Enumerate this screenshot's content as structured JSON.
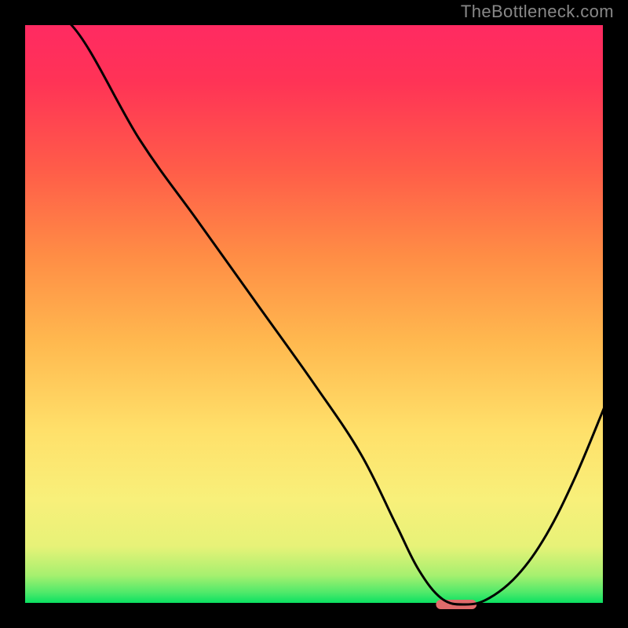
{
  "watermark": "TheBottleneck.com",
  "chart_data": {
    "type": "line",
    "title": "",
    "xlabel": "",
    "ylabel": "",
    "xlim": [
      0,
      100
    ],
    "ylim": [
      0,
      100
    ],
    "series": [
      {
        "name": "curve",
        "x": [
          0,
          8,
          20,
          30,
          40,
          50,
          58,
          64,
          68,
          72,
          76,
          80,
          85,
          90,
          95,
          100
        ],
        "y": [
          100,
          100,
          80,
          66,
          52,
          38,
          26,
          14,
          6,
          1,
          0,
          1,
          5,
          12,
          22,
          34
        ]
      }
    ],
    "minimum_marker": {
      "x_start": 71,
      "x_end": 78,
      "y": 0
    },
    "gradient_stops": [
      {
        "pct": 0,
        "color": "#00e060"
      },
      {
        "pct": 2,
        "color": "#4de96a"
      },
      {
        "pct": 5,
        "color": "#a6f06f"
      },
      {
        "pct": 10,
        "color": "#e7f278"
      },
      {
        "pct": 18,
        "color": "#f8f07a"
      },
      {
        "pct": 30,
        "color": "#ffe06a"
      },
      {
        "pct": 45,
        "color": "#ffb94f"
      },
      {
        "pct": 60,
        "color": "#ff8d45"
      },
      {
        "pct": 75,
        "color": "#ff5c49"
      },
      {
        "pct": 90,
        "color": "#ff3356"
      },
      {
        "pct": 100,
        "color": "#ff2a62"
      }
    ]
  }
}
